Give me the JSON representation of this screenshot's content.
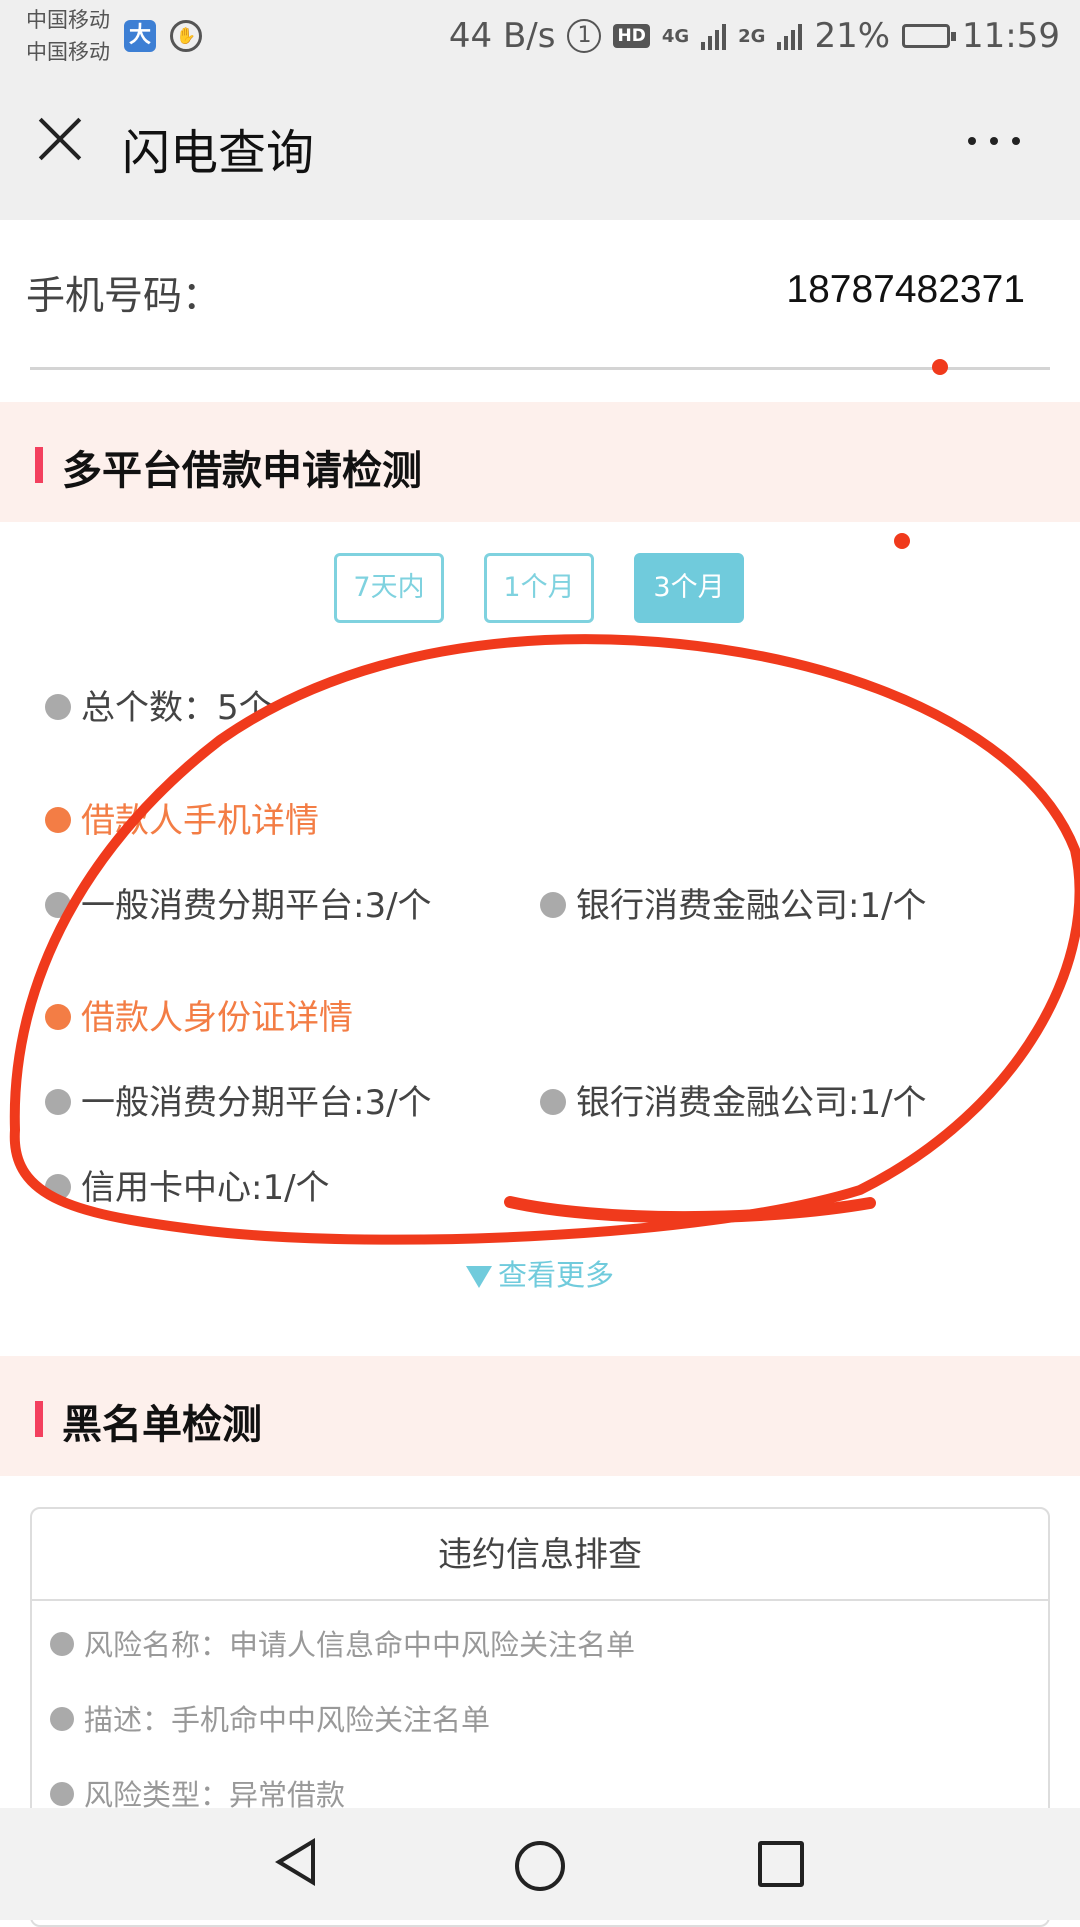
{
  "status_bar": {
    "carrier_1": "中国移动",
    "carrier_2": "中国移动",
    "speed": "44 B/s",
    "network_1": "4G",
    "network_2": "2G",
    "battery": "21%",
    "time": "11:59"
  },
  "header": {
    "title": "闪电查询"
  },
  "phone": {
    "label": "手机号码：",
    "value": "18787482371"
  },
  "multi_platform": {
    "title": "多平台借款申请检测",
    "tabs": [
      {
        "label": "7天内",
        "active": false
      },
      {
        "label": "1个月",
        "active": false
      },
      {
        "label": "3个月",
        "active": true
      }
    ],
    "total": "总个数：5个",
    "phone_detail": {
      "title": "借款人手机详情",
      "items": [
        "一般消费分期平台:3/个",
        "银行消费金融公司:1/个"
      ]
    },
    "id_detail": {
      "title": "借款人身份证详情",
      "items": [
        "一般消费分期平台:3/个",
        "银行消费金融公司:1/个",
        "信用卡中心:1/个"
      ]
    },
    "see_more": "查看更多"
  },
  "blacklist": {
    "title": "黑名单检测",
    "card_title": "违约信息排查",
    "rows": [
      "风险名称：申请人信息命中中风险关注名单",
      "描述：手机命中中风险关注名单",
      "风险类型：异常借款"
    ]
  },
  "colors": {
    "accent_teal": "#70cbdc",
    "accent_orange": "#f37d45",
    "section_bar": "#f3405e",
    "section_bg": "#fdf0ec",
    "annotation_red": "#f03a1c"
  }
}
